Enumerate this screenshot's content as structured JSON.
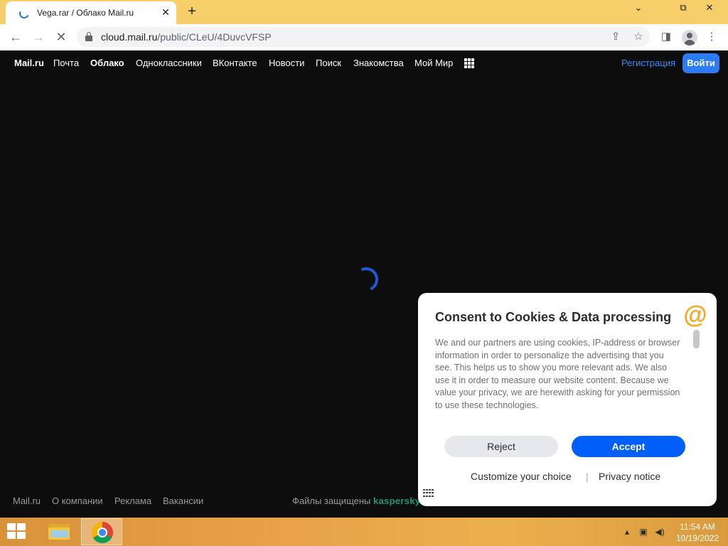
{
  "browser": {
    "tab_title": "Vega.rar / Облако Mail.ru",
    "tab_close": "✕",
    "new_tab": "+",
    "url_host": "cloud.mail.ru",
    "url_path": "/public/CLeU/4DuvcVFSP",
    "window_controls": {
      "minimize": "⌄",
      "restore": "⧉",
      "close": "✕"
    }
  },
  "site_nav": {
    "items": [
      "Mail.ru",
      "Почта",
      "Облако",
      "Одноклассники",
      "ВКонтакте",
      "Новости",
      "Поиск",
      "Знакомства",
      "Мой Мир"
    ],
    "register_label": "Регистрация",
    "login_label": "Войти"
  },
  "footer": {
    "links": [
      "Mail.ru",
      "О компании",
      "Реклама",
      "Вакансии"
    ],
    "protected_text": "Файлы защищены",
    "protected_brand": "kaspersky"
  },
  "consent": {
    "title": "Consent to Cookies & Data processing",
    "logo_glyph": "@",
    "body": "We and our partners are using cookies, IP-address or browser information in order to personalize the advertising that you see. This helps us to show you more relevant ads. We also use it in order to measure our website content. Because we value your privacy, we are herewith asking for your permission to use these technologies.",
    "reject_label": "Reject",
    "accept_label": "Accept",
    "customize_label": "Customize your choice",
    "separator": "|",
    "privacy_label": "Privacy notice"
  },
  "taskbar": {
    "time": "11:54 AM",
    "date": "10/19/2022"
  },
  "colors": {
    "tabstrip": "#f6cf6a",
    "page_bg": "#0d0d0d",
    "link_blue": "#3d89ff",
    "accept_blue": "#005ff9",
    "kaspersky_green": "#1f9a6f",
    "mail_orange": "#f5a623"
  }
}
